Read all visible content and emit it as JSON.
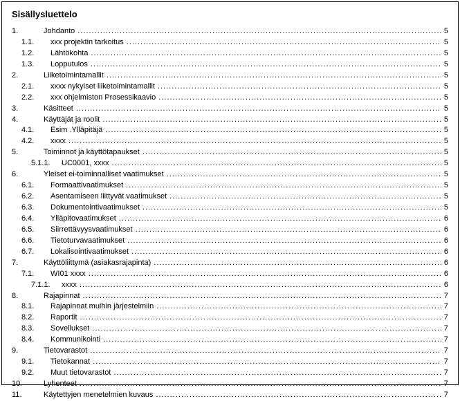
{
  "title": "Sisällysluettelo",
  "entries": [
    {
      "level": 1,
      "num": "1.",
      "label": "Johdanto",
      "page": "5"
    },
    {
      "level": 2,
      "num": "1.1.",
      "label": "xxx projektin tarkoitus",
      "page": "5"
    },
    {
      "level": 2,
      "num": "1.2.",
      "label": "Lähtökohta",
      "page": "5"
    },
    {
      "level": 2,
      "num": "1.3.",
      "label": "Lopputulos",
      "page": "5"
    },
    {
      "level": 1,
      "num": "2.",
      "label": "Liiketoimintamallit",
      "page": "5"
    },
    {
      "level": 2,
      "num": "2.1.",
      "label": "xxxx nykyiset liiketoimintamallit",
      "page": "5"
    },
    {
      "level": 2,
      "num": "2.2.",
      "label": "xxx ohjelmiston Prosessikaavio",
      "page": "5"
    },
    {
      "level": 1,
      "num": "3.",
      "label": "Käsitteet",
      "page": "5"
    },
    {
      "level": 1,
      "num": "4.",
      "label": "Käyttäjät ja roolit",
      "page": "5"
    },
    {
      "level": 2,
      "num": "4.1.",
      "label": "Esim .Ylläpitäjä",
      "page": "5"
    },
    {
      "level": 2,
      "num": "4.2.",
      "label": "xxxx",
      "page": "5"
    },
    {
      "level": 1,
      "num": "5.",
      "label": "Toiminnot ja käyttötapaukset",
      "page": "5"
    },
    {
      "level": 3,
      "num": "5.1.1.",
      "label": "UC0001, xxxx",
      "page": "5"
    },
    {
      "level": 1,
      "num": "6.",
      "label": "Yleiset ei-toiminnalliset vaatimukset",
      "page": "5"
    },
    {
      "level": 2,
      "num": "6.1.",
      "label": "Formaattivaatimukset",
      "page": "5"
    },
    {
      "level": 2,
      "num": "6.2.",
      "label": "Asentamiseen liittyvät vaatimukset",
      "page": "5"
    },
    {
      "level": 2,
      "num": "6.3.",
      "label": "Dokumentointivaatimukset",
      "page": "5"
    },
    {
      "level": 2,
      "num": "6.4.",
      "label": "Ylläpitovaatimukset",
      "page": "6"
    },
    {
      "level": 2,
      "num": "6.5.",
      "label": "Siirrettävyysvaatimukset",
      "page": "6"
    },
    {
      "level": 2,
      "num": "6.6.",
      "label": "Tietoturvavaatimukset",
      "page": "6"
    },
    {
      "level": 2,
      "num": "6.7.",
      "label": "Lokalisointivaatimukset",
      "page": "6"
    },
    {
      "level": 1,
      "num": "7.",
      "label": "Käyttöliittymä (asiakasrajapinta)",
      "page": "6"
    },
    {
      "level": 2,
      "num": "7.1.",
      "label": "WI01 xxxx",
      "page": "6"
    },
    {
      "level": 3,
      "num": "7.1.1.",
      "label": "xxxx",
      "page": "6"
    },
    {
      "level": 1,
      "num": "8.",
      "label": "Rajapinnat",
      "page": "7"
    },
    {
      "level": 2,
      "num": "8.1.",
      "label": "Rajapinnat muihin järjestelmiin",
      "page": "7"
    },
    {
      "level": 2,
      "num": "8.2.",
      "label": "Raportit",
      "page": "7"
    },
    {
      "level": 2,
      "num": "8.3.",
      "label": "Sovellukset",
      "page": "7"
    },
    {
      "level": 2,
      "num": "8.4.",
      "label": "Kommunikointi",
      "page": "7"
    },
    {
      "level": 1,
      "num": "9.",
      "label": "Tietovarastot",
      "page": "7"
    },
    {
      "level": 2,
      "num": "9.1.",
      "label": "Tietokannat",
      "page": "7"
    },
    {
      "level": 2,
      "num": "9.2.",
      "label": "Muut tietovarastot",
      "page": "7"
    },
    {
      "level": 1,
      "num": "10.",
      "label": "Lyhenteet",
      "page": "7"
    },
    {
      "level": 1,
      "num": "11.",
      "label": "Käytettyjen menetelmien kuvaus",
      "page": "7"
    }
  ]
}
